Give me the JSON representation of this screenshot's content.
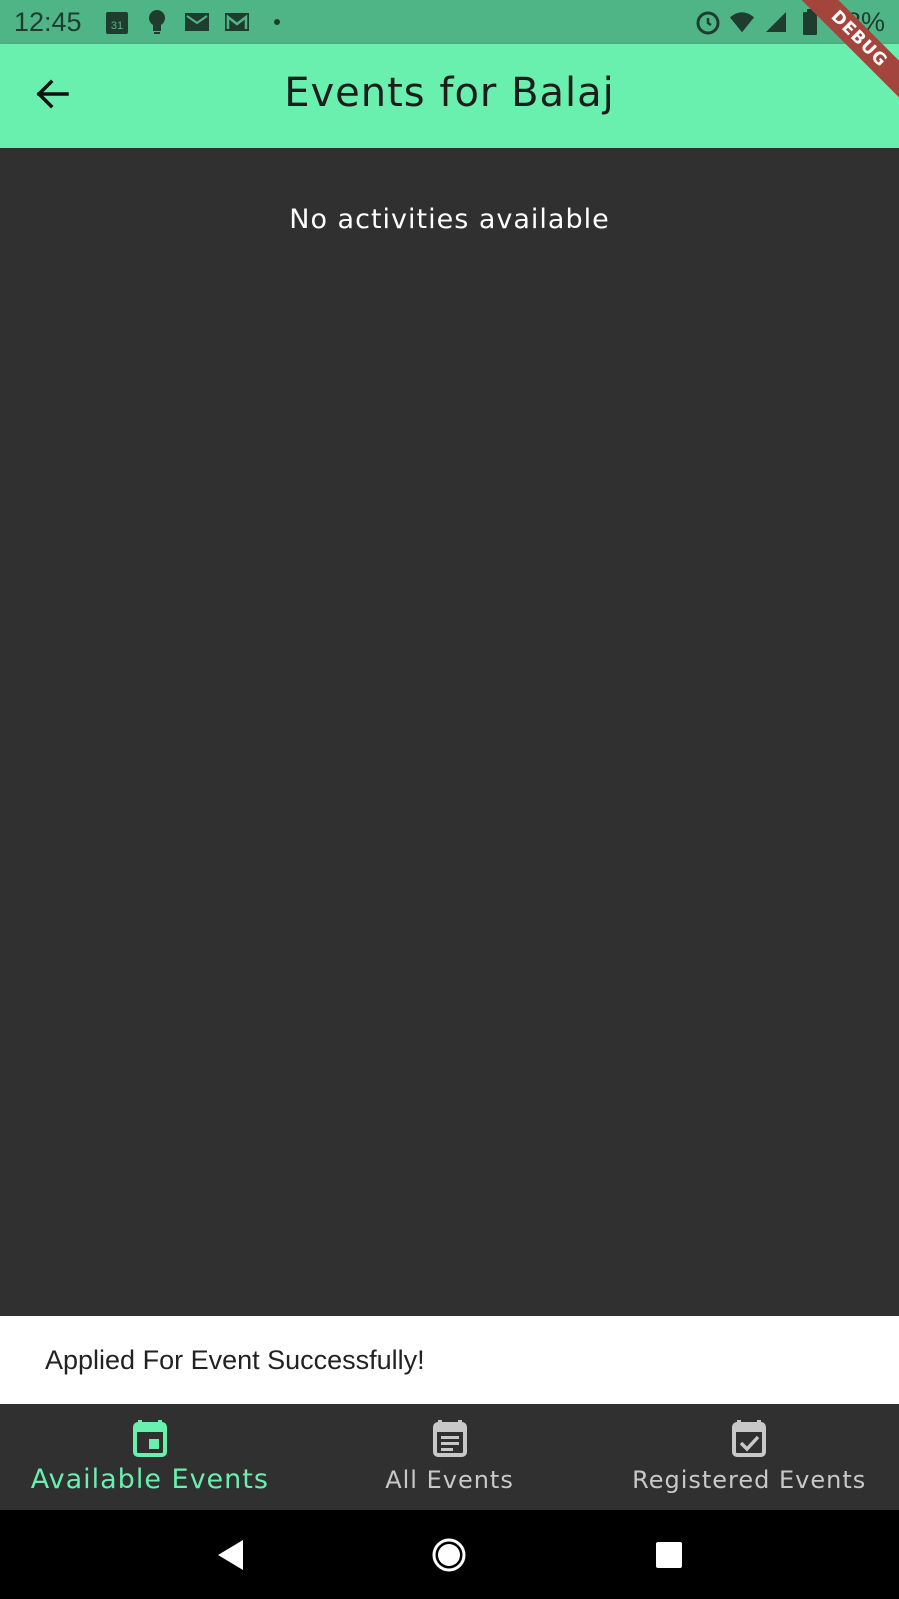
{
  "status_bar": {
    "time": "12:45",
    "battery_text": "98%",
    "calendar_day": "31"
  },
  "debug_banner": {
    "label": "DEBUG"
  },
  "app_bar": {
    "title": "Events for Balaj"
  },
  "content": {
    "empty_message": "No activities available"
  },
  "snackbar": {
    "message": "Applied For Event Successfully!"
  },
  "bottom_nav": {
    "active_color": "#69f0ae",
    "inactive_color": "#c8c8c8",
    "items": [
      {
        "label": "Available Events",
        "icon": "calendar-today-icon",
        "active": true
      },
      {
        "label": "All Events",
        "icon": "event-note-icon",
        "active": false
      },
      {
        "label": "Registered Events",
        "icon": "event-available-icon",
        "active": false
      }
    ]
  },
  "colors": {
    "app_bar": "#69f0ae",
    "status_bar": "#4fb486",
    "background": "#303030",
    "snackbar": "#ffffff"
  }
}
